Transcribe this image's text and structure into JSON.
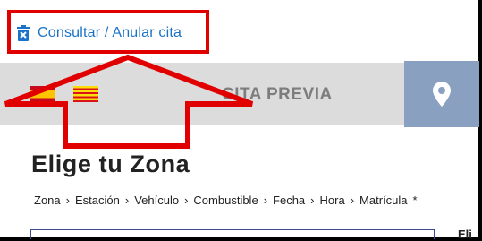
{
  "top_link": {
    "label": "Consultar / Anular cita",
    "icon": "trash-icon",
    "color": "#1a73c8"
  },
  "header": {
    "title": "CITA PREVIA",
    "flags": [
      "spain-flag",
      "catalonia-flag"
    ],
    "location_icon": "map-pin-icon",
    "bar_color": "#dcdcdc",
    "button_color": "#8aa0c0"
  },
  "main": {
    "title": "Elige tu Zona",
    "breadcrumb": [
      {
        "label": "Zona",
        "sep": "›"
      },
      {
        "label": "Estación",
        "sep": "›"
      },
      {
        "label": "Vehículo",
        "sep": "›"
      },
      {
        "label": "Combustible",
        "sep": "›"
      },
      {
        "label": "Fecha",
        "sep": "›"
      },
      {
        "label": "Hora",
        "sep": "›"
      },
      {
        "label": "Matrícula",
        "sep": "*"
      }
    ],
    "right_fragment": "Eli"
  },
  "annotation": {
    "color": "#e00000"
  }
}
